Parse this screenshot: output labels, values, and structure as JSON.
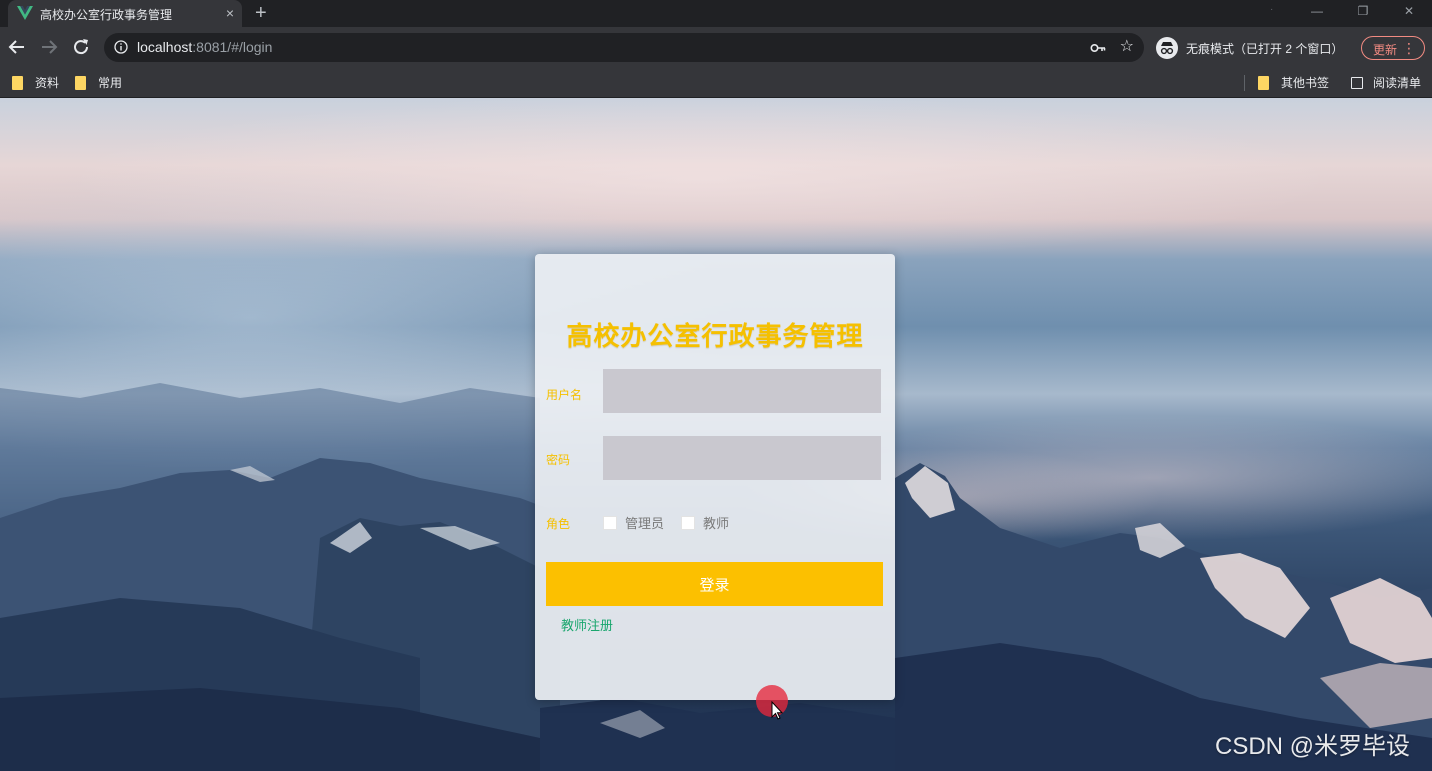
{
  "browser": {
    "tab_title": "高校办公室行政事务管理",
    "tab_close": "×",
    "new_tab": "+",
    "url_host": "localhost",
    "url_rest": ":8081/#/login",
    "star": "☆",
    "incognito_label": "无痕模式（已打开 2 个窗口）",
    "update_label": "更新",
    "update_menu": "⋮",
    "window_controls": [
      "—",
      "❐",
      "✕"
    ]
  },
  "bookmarks": {
    "left": [
      "资料",
      "常用"
    ],
    "other": "其他书签",
    "reading_list": "阅读清单"
  },
  "login": {
    "title": "高校办公室行政事务管理",
    "username_label": "用户名",
    "password_label": "密码",
    "username_value": "",
    "password_value": "",
    "role_label": "角色",
    "roles": [
      "管理员",
      "教师"
    ],
    "login_button": "登录",
    "register_link": "教师注册"
  },
  "watermark": "CSDN @米罗毕设",
  "colors": {
    "accent": "#fcc000",
    "title": "#f5c000",
    "link": "#1aa66e",
    "input_bg": "#c9c8cf",
    "update": "#f28b82"
  }
}
